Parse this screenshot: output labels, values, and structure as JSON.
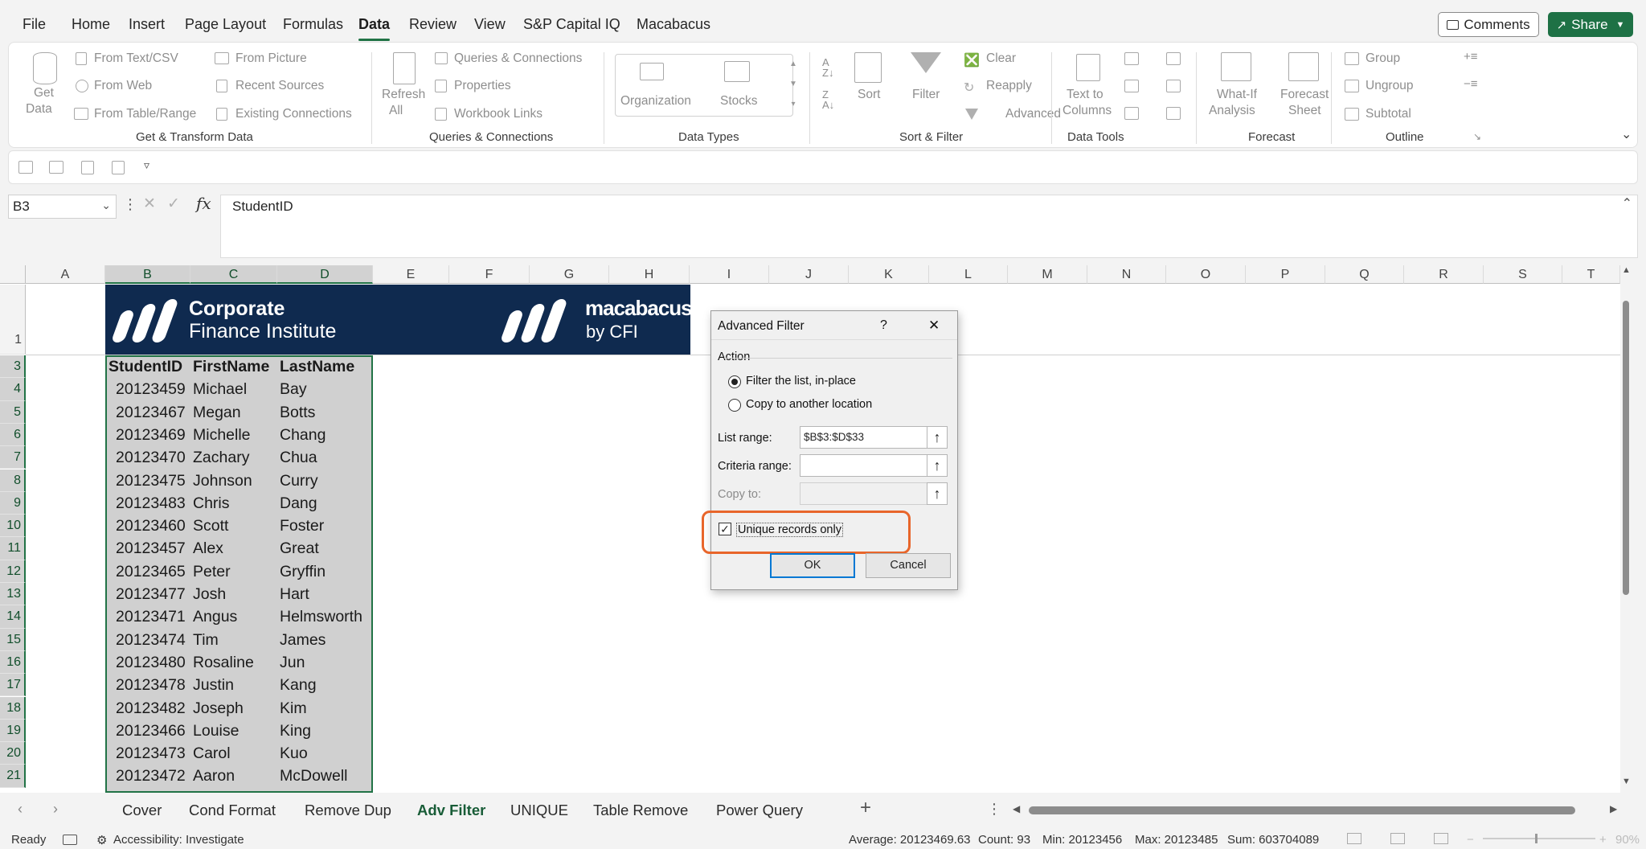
{
  "menu": {
    "file": "File",
    "home": "Home",
    "insert": "Insert",
    "page_layout": "Page Layout",
    "formulas": "Formulas",
    "data": "Data",
    "review": "Review",
    "view": "View",
    "capital_iq": "S&P Capital IQ",
    "macabacus": "Macabacus",
    "comments": "Comments",
    "share": "Share"
  },
  "ribbon": {
    "get_data": "Get",
    "get_data2": "Data",
    "from_text_csv": "From Text/CSV",
    "from_web": "From Web",
    "from_table_range": "From Table/Range",
    "from_picture": "From Picture",
    "recent_sources": "Recent Sources",
    "existing_connections": "Existing Connections",
    "group_get_transform": "Get & Transform Data",
    "refresh": "Refresh",
    "refresh2": "All",
    "queries_connections": "Queries & Connections",
    "properties": "Properties",
    "workbook_links": "Workbook Links",
    "group_queries": "Queries & Connections",
    "organization": "Organization",
    "stocks": "Stocks",
    "group_data_types": "Data Types",
    "sort": "Sort",
    "filter": "Filter",
    "clear": "Clear",
    "reapply": "Reapply",
    "advanced": "Advanced",
    "group_sort_filter": "Sort & Filter",
    "text_to": "Text to",
    "columns": "Columns",
    "group_data_tools": "Data Tools",
    "what_if": "What-If",
    "analysis": "Analysis",
    "forecast_sheet": "Forecast",
    "sheet": "Sheet",
    "group_forecast": "Forecast",
    "group": "Group",
    "ungroup": "Ungroup",
    "subtotal": "Subtotal",
    "group_outline": "Outline"
  },
  "formula_bar": {
    "name_box": "B3",
    "fx": "fx",
    "content": "StudentID"
  },
  "columns": [
    "A",
    "B",
    "C",
    "D",
    "E",
    "F",
    "G",
    "H",
    "I",
    "J",
    "K",
    "L",
    "M",
    "N",
    "O",
    "P",
    "Q",
    "R",
    "S",
    "T"
  ],
  "rows": [
    "1",
    "3",
    "4",
    "5",
    "6",
    "7",
    "8",
    "9",
    "10",
    "11",
    "12",
    "13",
    "14",
    "15",
    "16",
    "17",
    "18",
    "19",
    "20",
    "21"
  ],
  "banner": {
    "cfi_line1": "Corporate",
    "cfi_line2": "Finance Institute",
    "mac_line1": "macabacus",
    "mac_line2": "by CFI"
  },
  "table": {
    "headers": [
      "StudentID",
      "FirstName",
      "LastName"
    ],
    "rows": [
      [
        "20123459",
        "Michael",
        "Bay"
      ],
      [
        "20123467",
        "Megan",
        "Botts"
      ],
      [
        "20123469",
        "Michelle",
        "Chang"
      ],
      [
        "20123470",
        "Zachary",
        "Chua"
      ],
      [
        "20123475",
        "Johnson",
        "Curry"
      ],
      [
        "20123483",
        "Chris",
        "Dang"
      ],
      [
        "20123460",
        "Scott",
        "Foster"
      ],
      [
        "20123457",
        "Alex",
        "Great"
      ],
      [
        "20123465",
        "Peter",
        "Gryffin"
      ],
      [
        "20123477",
        "Josh",
        "Hart"
      ],
      [
        "20123471",
        "Angus",
        "Helmsworth"
      ],
      [
        "20123474",
        "Tim",
        "James"
      ],
      [
        "20123480",
        "Rosaline",
        "Jun"
      ],
      [
        "20123478",
        "Justin",
        "Kang"
      ],
      [
        "20123482",
        "Joseph",
        "Kim"
      ],
      [
        "20123466",
        "Louise",
        "King"
      ],
      [
        "20123473",
        "Carol",
        "Kuo"
      ],
      [
        "20123472",
        "Aaron",
        "McDowell"
      ]
    ]
  },
  "dialog": {
    "title": "Advanced Filter",
    "help": "?",
    "close": "✕",
    "action": "Action",
    "filter_in_place": "Filter the list, in-place",
    "copy_to_location": "Copy to another location",
    "list_range_label": "List range:",
    "list_range_value": "$B$3:$D$33",
    "criteria_range_label": "Criteria range:",
    "criteria_range_value": "",
    "copy_to_label": "Copy to:",
    "copy_to_value": "",
    "unique_records": "Unique records only",
    "ok": "OK",
    "cancel": "Cancel",
    "highlight_color": "#e8652a"
  },
  "sheet_tabs": [
    "Cover",
    "Cond Format",
    "Remove Dup",
    "Adv Filter",
    "UNIQUE",
    "Table Remove",
    "Power Query"
  ],
  "active_tab": "Adv Filter",
  "status": {
    "ready": "Ready",
    "accessibility": "Accessibility: Investigate",
    "average": "Average: 20123469.63",
    "count": "Count: 93",
    "min": "Min: 20123456",
    "max": "Max: 20123485",
    "sum": "Sum: 603704089",
    "zoom": "90%"
  },
  "colors": {
    "excel_green": "#217346",
    "banner_navy": "#0f2a4f",
    "selection_gray": "#d0d0d0"
  }
}
